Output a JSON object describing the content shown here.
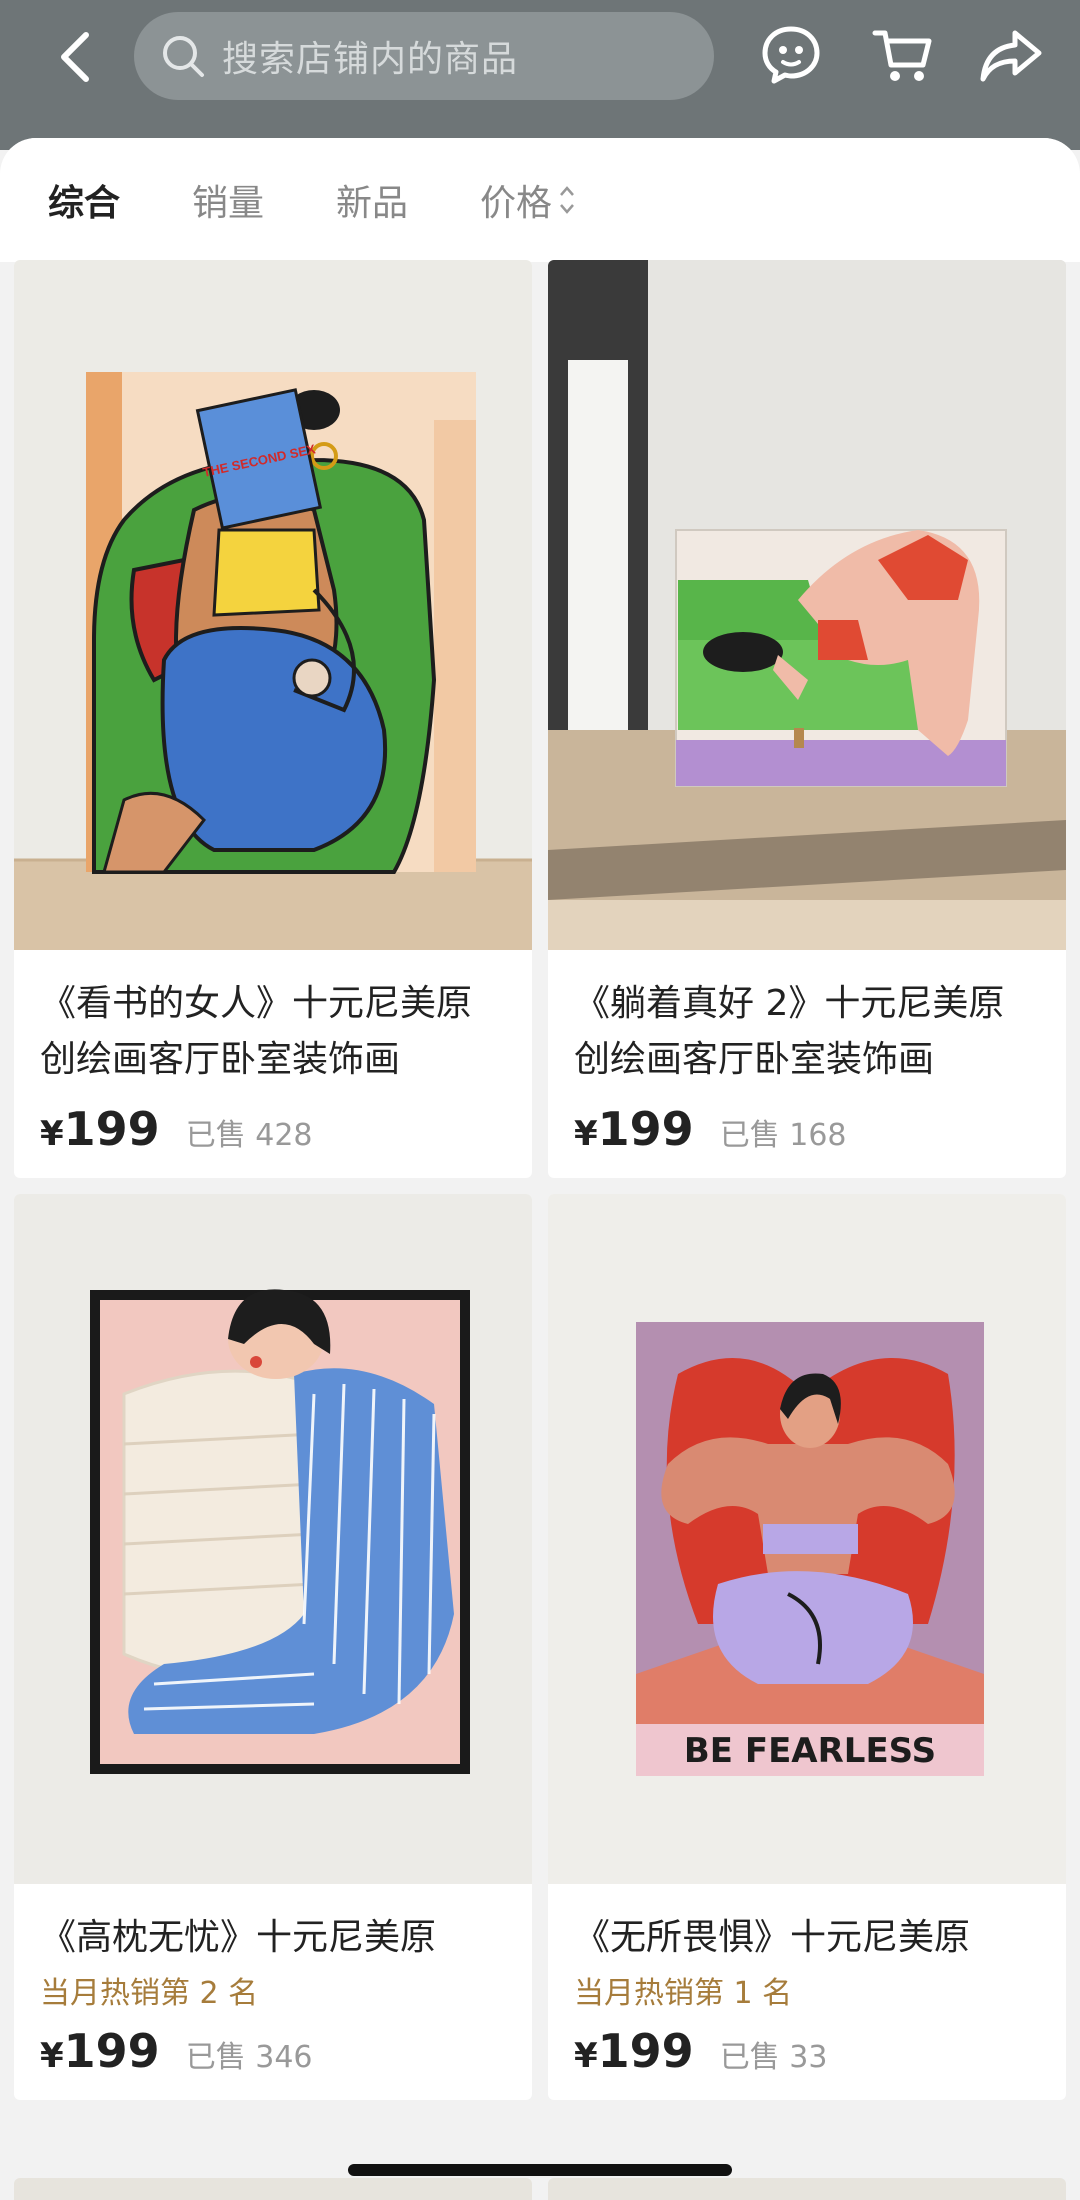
{
  "header": {
    "search_placeholder": "搜索店铺内的商品",
    "icons": [
      "back-icon",
      "search-icon",
      "customer-service-icon",
      "cart-icon",
      "share-icon"
    ]
  },
  "sort_tabs": [
    {
      "label": "综合",
      "active": true
    },
    {
      "label": "销量",
      "active": false
    },
    {
      "label": "新品",
      "active": false
    },
    {
      "label": "价格",
      "active": false
    }
  ],
  "products": [
    {
      "title": "《看书的女人》十元尼美原创绘画客厅卧室装饰画",
      "currency": "¥",
      "price": "199",
      "sold": "已售 428"
    },
    {
      "title": "《躺着真好 2》十元尼美原创绘画客厅卧室装饰画",
      "currency": "¥",
      "price": "199",
      "sold": "已售 168"
    },
    {
      "title": "《高枕无忧》十元尼美原",
      "rank": "当月热销第 2 名",
      "currency": "¥",
      "price": "199",
      "sold": "已售 346"
    },
    {
      "title": "《无所畏惧》十元尼美原",
      "rank": "当月热销第 1 名",
      "currency": "¥",
      "price": "199",
      "sold": "已售 33"
    }
  ],
  "artwork_texts": {
    "book_cover": "THE SECOND SEX",
    "poster_caption": "BE FEARLESS"
  },
  "colors": {
    "header_bg": "#6e7577",
    "rank_text": "#a67c3b"
  }
}
